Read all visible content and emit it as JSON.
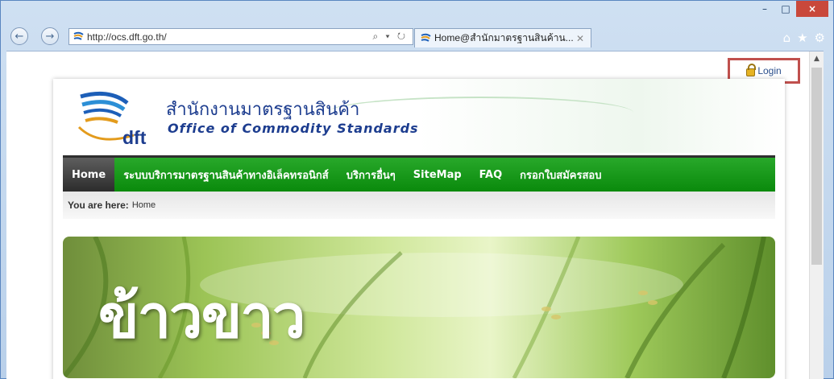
{
  "browser": {
    "address": "http://ocs.dft.go.th/",
    "address_ctl": "⌕ ▾ ↻",
    "tab_title": "Home@สำนักมาตรฐานสินค้าน...",
    "window_controls": [
      "–",
      "□",
      "×"
    ],
    "toolbar_icons": [
      "home-icon",
      "star-icon",
      "gear-icon"
    ]
  },
  "login": {
    "label": "Login"
  },
  "header": {
    "title_th": "สำนักงานมาตรฐานสินค้า",
    "title_en": "Office of Commodity Standards",
    "logo_text": "dft"
  },
  "menu": {
    "items": [
      "Home",
      "ระบบบริการมาตรฐานสินค้าทางอิเล็คทรอนิกส์",
      "บริการอื่นๆ",
      "SiteMap",
      "FAQ",
      "กรอกใบสมัครสอบ"
    ]
  },
  "breadcrumb": {
    "prefix": "You are here:",
    "current": "Home"
  },
  "banner": {
    "text": "ข้าวขาว"
  },
  "colors": {
    "menu_green": "#0a8a0c",
    "brand_blue": "#1d3d8f",
    "highlight_red": "#c0504d"
  }
}
